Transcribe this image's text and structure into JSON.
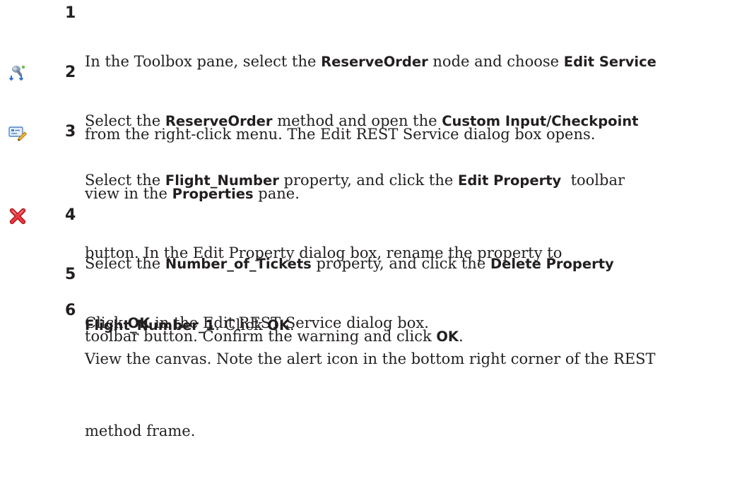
{
  "steps": [
    {
      "number": "1",
      "lines": [
        [
          {
            "t": "In the Toolbox pane, select the ",
            "b": false
          },
          {
            "t": "ReserveOrder",
            "b": true
          },
          {
            "t": " node and choose ",
            "b": false
          },
          {
            "t": "Edit Service",
            "b": true
          }
        ],
        [
          {
            "t": "from the right-click menu. The Edit REST Service dialog box opens.",
            "b": false
          }
        ]
      ]
    },
    {
      "number": "2",
      "icon": "custom-input-checkpoint-icon",
      "lines": [
        [
          {
            "t": "Select the ",
            "b": false
          },
          {
            "t": "ReserveOrder",
            "b": true
          },
          {
            "t": " method and open the ",
            "b": false
          },
          {
            "t": "Custom Input/Checkpoint",
            "b": true
          }
        ],
        [
          {
            "t": "view in the ",
            "b": false
          },
          {
            "t": "Properties",
            "b": true
          },
          {
            "t": " pane.",
            "b": false
          }
        ]
      ]
    },
    {
      "number": "3",
      "icon": "edit-property-icon",
      "lines": [
        [
          {
            "t": "Select the ",
            "b": false
          },
          {
            "t": "Flight_Number",
            "b": true
          },
          {
            "t": " property, and click the ",
            "b": false
          },
          {
            "t": "Edit Property",
            "b": true
          },
          {
            "t": "  toolbar",
            "b": false
          }
        ],
        [
          {
            "t": "button. In the Edit Property dialog box, rename the property to",
            "b": false
          }
        ],
        [
          {
            "t": "Flight_Number_1",
            "b": true
          },
          {
            "t": ". Click ",
            "b": false
          },
          {
            "t": "OK",
            "b": true
          },
          {
            "t": ".",
            "b": false
          }
        ]
      ]
    },
    {
      "number": "4",
      "icon": "delete-property-icon",
      "lines": [
        [
          {
            "t": "Select the ",
            "b": false
          },
          {
            "t": "Number_of_Tickets",
            "b": true
          },
          {
            "t": " property, and click the ",
            "b": false
          },
          {
            "t": "Delete Property",
            "b": true
          }
        ],
        [
          {
            "t": "toolbar button. Confirm the warning and click ",
            "b": false
          },
          {
            "t": "OK",
            "b": true
          },
          {
            "t": ".",
            "b": false
          }
        ]
      ]
    },
    {
      "number": "5",
      "lines": [
        [
          {
            "t": "Click ",
            "b": false
          },
          {
            "t": "OK",
            "b": true
          },
          {
            "t": " in the Edit REST Service dialog box.",
            "b": false
          }
        ]
      ]
    },
    {
      "number": "6",
      "lines": [
        [
          {
            "t": "View the canvas. Note the alert icon in the bottom right corner of the REST",
            "b": false
          }
        ],
        [
          {
            "t": "method frame.",
            "b": false
          }
        ]
      ]
    }
  ]
}
